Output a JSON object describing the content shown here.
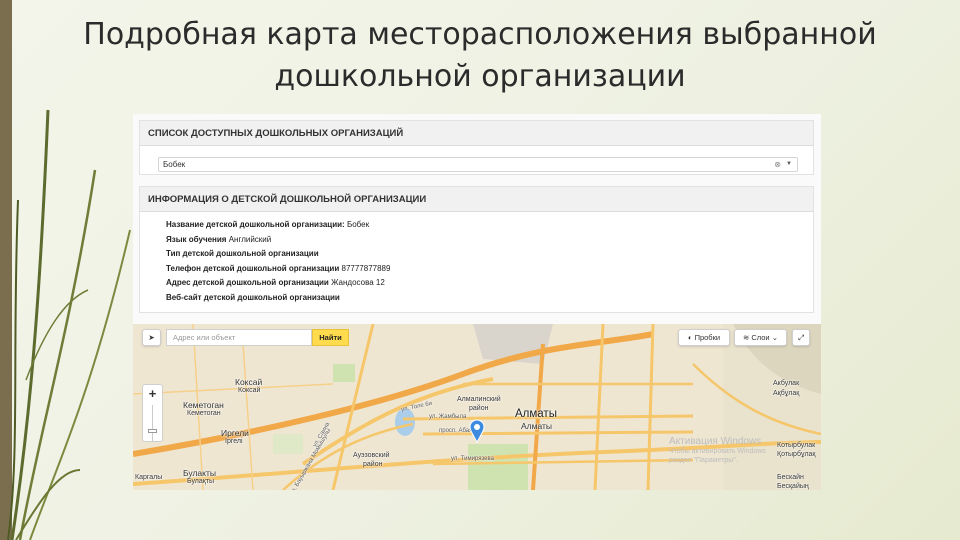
{
  "slide": {
    "title_line1": "Подробная карта месторасположения выбранной",
    "title_line2": "дошкольной организации"
  },
  "list_panel": {
    "header": "СПИСОК ДОСТУПНЫХ ДОШКОЛЬНЫХ ОРГАНИЗАЦИЙ",
    "selected_value": "Бобек",
    "clear_glyph": "⊗",
    "arrow_glyph": "▼"
  },
  "info_panel": {
    "header": "ИНФОРМАЦИЯ О ДЕТСКОЙ ДОШКОЛЬНОЙ ОРГАНИЗАЦИИ",
    "rows": [
      {
        "label": "Название детской дошкольной организации:",
        "value": "Бобек"
      },
      {
        "label": "Язык обучения",
        "value": "Английский"
      },
      {
        "label": "Тип детской дошкольной организации",
        "value": ""
      },
      {
        "label": "Телефон детской дошкольной организации",
        "value": "87777877889"
      },
      {
        "label": "Адрес детской дошкольной организации",
        "value": "Жандосова 12"
      },
      {
        "label": "Веб-сайт детской дошкольной организации",
        "value": ""
      }
    ]
  },
  "map": {
    "search_placeholder": "Адрес или объект",
    "find_button": "Найти",
    "traffic_button": "Пробки",
    "layers_button": "Слои",
    "zoom_in": "+",
    "colors": {
      "road": "#f6c66a",
      "major_road": "#f0a848",
      "park": "#cfe3b0",
      "water": "#aacdea",
      "pin": "#3d8be0"
    },
    "labels": [
      {
        "text": "Коксай",
        "cls": "mid"
      },
      {
        "text": "Коксай",
        "cls": ""
      },
      {
        "text": "Кеметоган",
        "cls": "mid"
      },
      {
        "text": "Кеметоган",
        "cls": ""
      },
      {
        "text": "Иргели",
        "cls": "mid"
      },
      {
        "text": "Іргелі",
        "cls": ""
      },
      {
        "text": "Булакты",
        "cls": "mid"
      },
      {
        "text": "Булақты",
        "cls": ""
      },
      {
        "text": "Каргалы",
        "cls": ""
      },
      {
        "text": "Алмалинский",
        "cls": ""
      },
      {
        "text": "район",
        "cls": ""
      },
      {
        "text": "Алматы",
        "cls": "big"
      },
      {
        "text": "Алматы",
        "cls": "mid"
      },
      {
        "text": "Ауэзовский",
        "cls": ""
      },
      {
        "text": "район",
        "cls": ""
      },
      {
        "text": "Акбулак",
        "cls": ""
      },
      {
        "text": "Ақбұлақ",
        "cls": ""
      },
      {
        "text": "Котырбулак",
        "cls": ""
      },
      {
        "text": "Қотырбұлақ",
        "cls": ""
      },
      {
        "text": "Бескайн",
        "cls": ""
      },
      {
        "text": "Бесқайың",
        "cls": ""
      },
      {
        "text": "ул. Толе би",
        "cls": "street"
      },
      {
        "text": "ул. Жамбыла",
        "cls": "street"
      },
      {
        "text": "просп. Абая",
        "cls": "street"
      },
      {
        "text": "ул. Тимирязева",
        "cls": "street"
      },
      {
        "text": "ул. Саина",
        "cls": "street"
      },
      {
        "text": "ул. Бауыржана Момышулы",
        "cls": "street"
      }
    ],
    "watermark_title": "Активация Windows",
    "watermark_line1": "Чтобы активировать Windows",
    "watermark_line2": "раздел \"Параметры\"."
  }
}
